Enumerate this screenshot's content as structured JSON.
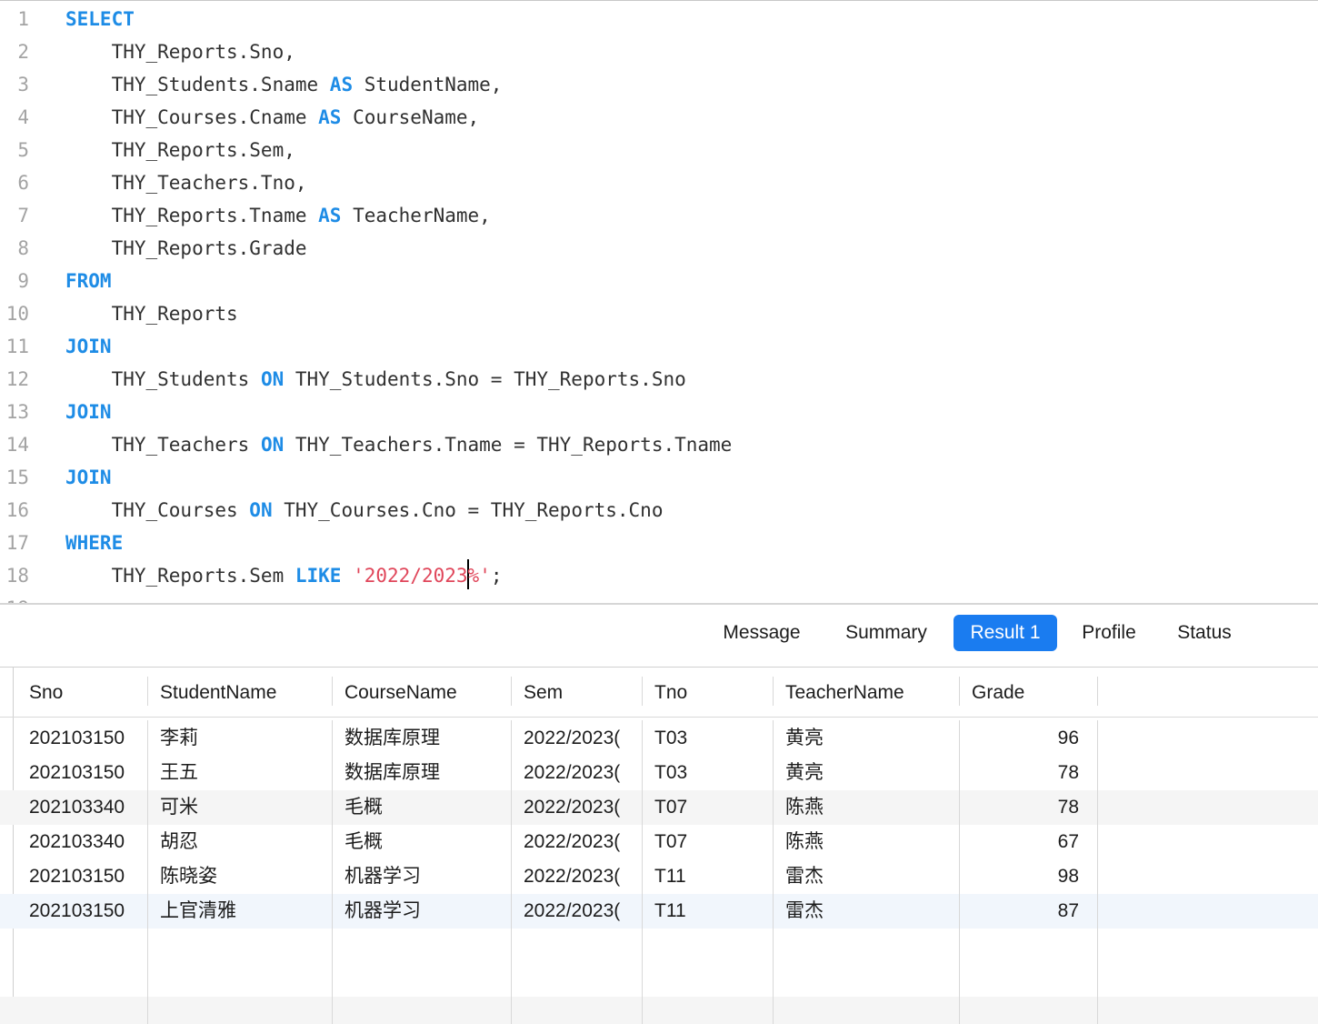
{
  "editor": {
    "lines": [
      {
        "n": "1",
        "tokens": [
          {
            "t": "SELECT",
            "c": "kw"
          }
        ]
      },
      {
        "n": "2",
        "tokens": [
          {
            "t": "    THY_Reports.Sno,",
            "c": ""
          }
        ]
      },
      {
        "n": "3",
        "tokens": [
          {
            "t": "    THY_Students.Sname ",
            "c": ""
          },
          {
            "t": "AS",
            "c": "kw"
          },
          {
            "t": " StudentName,",
            "c": ""
          }
        ]
      },
      {
        "n": "4",
        "tokens": [
          {
            "t": "    THY_Courses.Cname ",
            "c": ""
          },
          {
            "t": "AS",
            "c": "kw"
          },
          {
            "t": " CourseName,",
            "c": ""
          }
        ]
      },
      {
        "n": "5",
        "tokens": [
          {
            "t": "    THY_Reports.Sem,",
            "c": ""
          }
        ]
      },
      {
        "n": "6",
        "tokens": [
          {
            "t": "    THY_Teachers.Tno,",
            "c": ""
          }
        ]
      },
      {
        "n": "7",
        "tokens": [
          {
            "t": "    THY_Reports.Tname ",
            "c": ""
          },
          {
            "t": "AS",
            "c": "kw"
          },
          {
            "t": " TeacherName,",
            "c": ""
          }
        ]
      },
      {
        "n": "8",
        "tokens": [
          {
            "t": "    THY_Reports.Grade",
            "c": ""
          }
        ]
      },
      {
        "n": "9",
        "tokens": [
          {
            "t": "FROM",
            "c": "kw"
          }
        ]
      },
      {
        "n": "10",
        "tokens": [
          {
            "t": "    THY_Reports",
            "c": ""
          }
        ]
      },
      {
        "n": "11",
        "tokens": [
          {
            "t": "JOIN",
            "c": "kw"
          }
        ]
      },
      {
        "n": "12",
        "tokens": [
          {
            "t": "    THY_Students ",
            "c": ""
          },
          {
            "t": "ON",
            "c": "kw"
          },
          {
            "t": " THY_Students.Sno = THY_Reports.Sno",
            "c": ""
          }
        ]
      },
      {
        "n": "13",
        "tokens": [
          {
            "t": "JOIN",
            "c": "kw"
          }
        ]
      },
      {
        "n": "14",
        "tokens": [
          {
            "t": "    THY_Teachers ",
            "c": ""
          },
          {
            "t": "ON",
            "c": "kw"
          },
          {
            "t": " THY_Teachers.Tname = THY_Reports.Tname",
            "c": ""
          }
        ]
      },
      {
        "n": "15",
        "tokens": [
          {
            "t": "JOIN",
            "c": "kw"
          }
        ]
      },
      {
        "n": "16",
        "tokens": [
          {
            "t": "    THY_Courses ",
            "c": ""
          },
          {
            "t": "ON",
            "c": "kw"
          },
          {
            "t": " THY_Courses.Cno = THY_Reports.Cno",
            "c": ""
          }
        ]
      },
      {
        "n": "17",
        "tokens": [
          {
            "t": "WHERE",
            "c": "kw"
          }
        ]
      },
      {
        "n": "18",
        "tokens": [
          {
            "t": "    THY_Reports.Sem ",
            "c": ""
          },
          {
            "t": "LIKE",
            "c": "kw"
          },
          {
            "t": " ",
            "c": ""
          },
          {
            "t": "'2022/2023",
            "c": "str"
          },
          {
            "t": "|",
            "c": "caret"
          },
          {
            "t": "%'",
            "c": "str"
          },
          {
            "t": ";",
            "c": ""
          }
        ]
      },
      {
        "n": "19",
        "tokens": []
      }
    ]
  },
  "tabs": [
    {
      "label": "Message",
      "active": false
    },
    {
      "label": "Summary",
      "active": false
    },
    {
      "label": "Result 1",
      "active": true
    },
    {
      "label": "Profile",
      "active": false
    },
    {
      "label": "Status",
      "active": false
    }
  ],
  "grid": {
    "columns": [
      "Sno",
      "StudentName",
      "CourseName",
      "Sem",
      "Tno",
      "TeacherName",
      "Grade"
    ],
    "rows": [
      [
        "202103150",
        "李莉",
        "数据库原理",
        "2022/2023(",
        "T03",
        "黄亮",
        "96"
      ],
      [
        "202103150",
        "王五",
        "数据库原理",
        "2022/2023(",
        "T03",
        "黄亮",
        "78"
      ],
      [
        "202103340",
        "可米",
        "毛概",
        "2022/2023(",
        "T07",
        "陈燕",
        "78"
      ],
      [
        "202103340",
        "胡忍",
        "毛概",
        "2022/2023(",
        "T07",
        "陈燕",
        "67"
      ],
      [
        "202103150",
        "陈晓姿",
        "机器学习",
        "2022/2023(",
        "T11",
        "雷杰",
        "98"
      ],
      [
        "202103150",
        "上官清雅",
        "机器学习",
        "2022/2023(",
        "T11",
        "雷杰",
        "87"
      ]
    ]
  }
}
